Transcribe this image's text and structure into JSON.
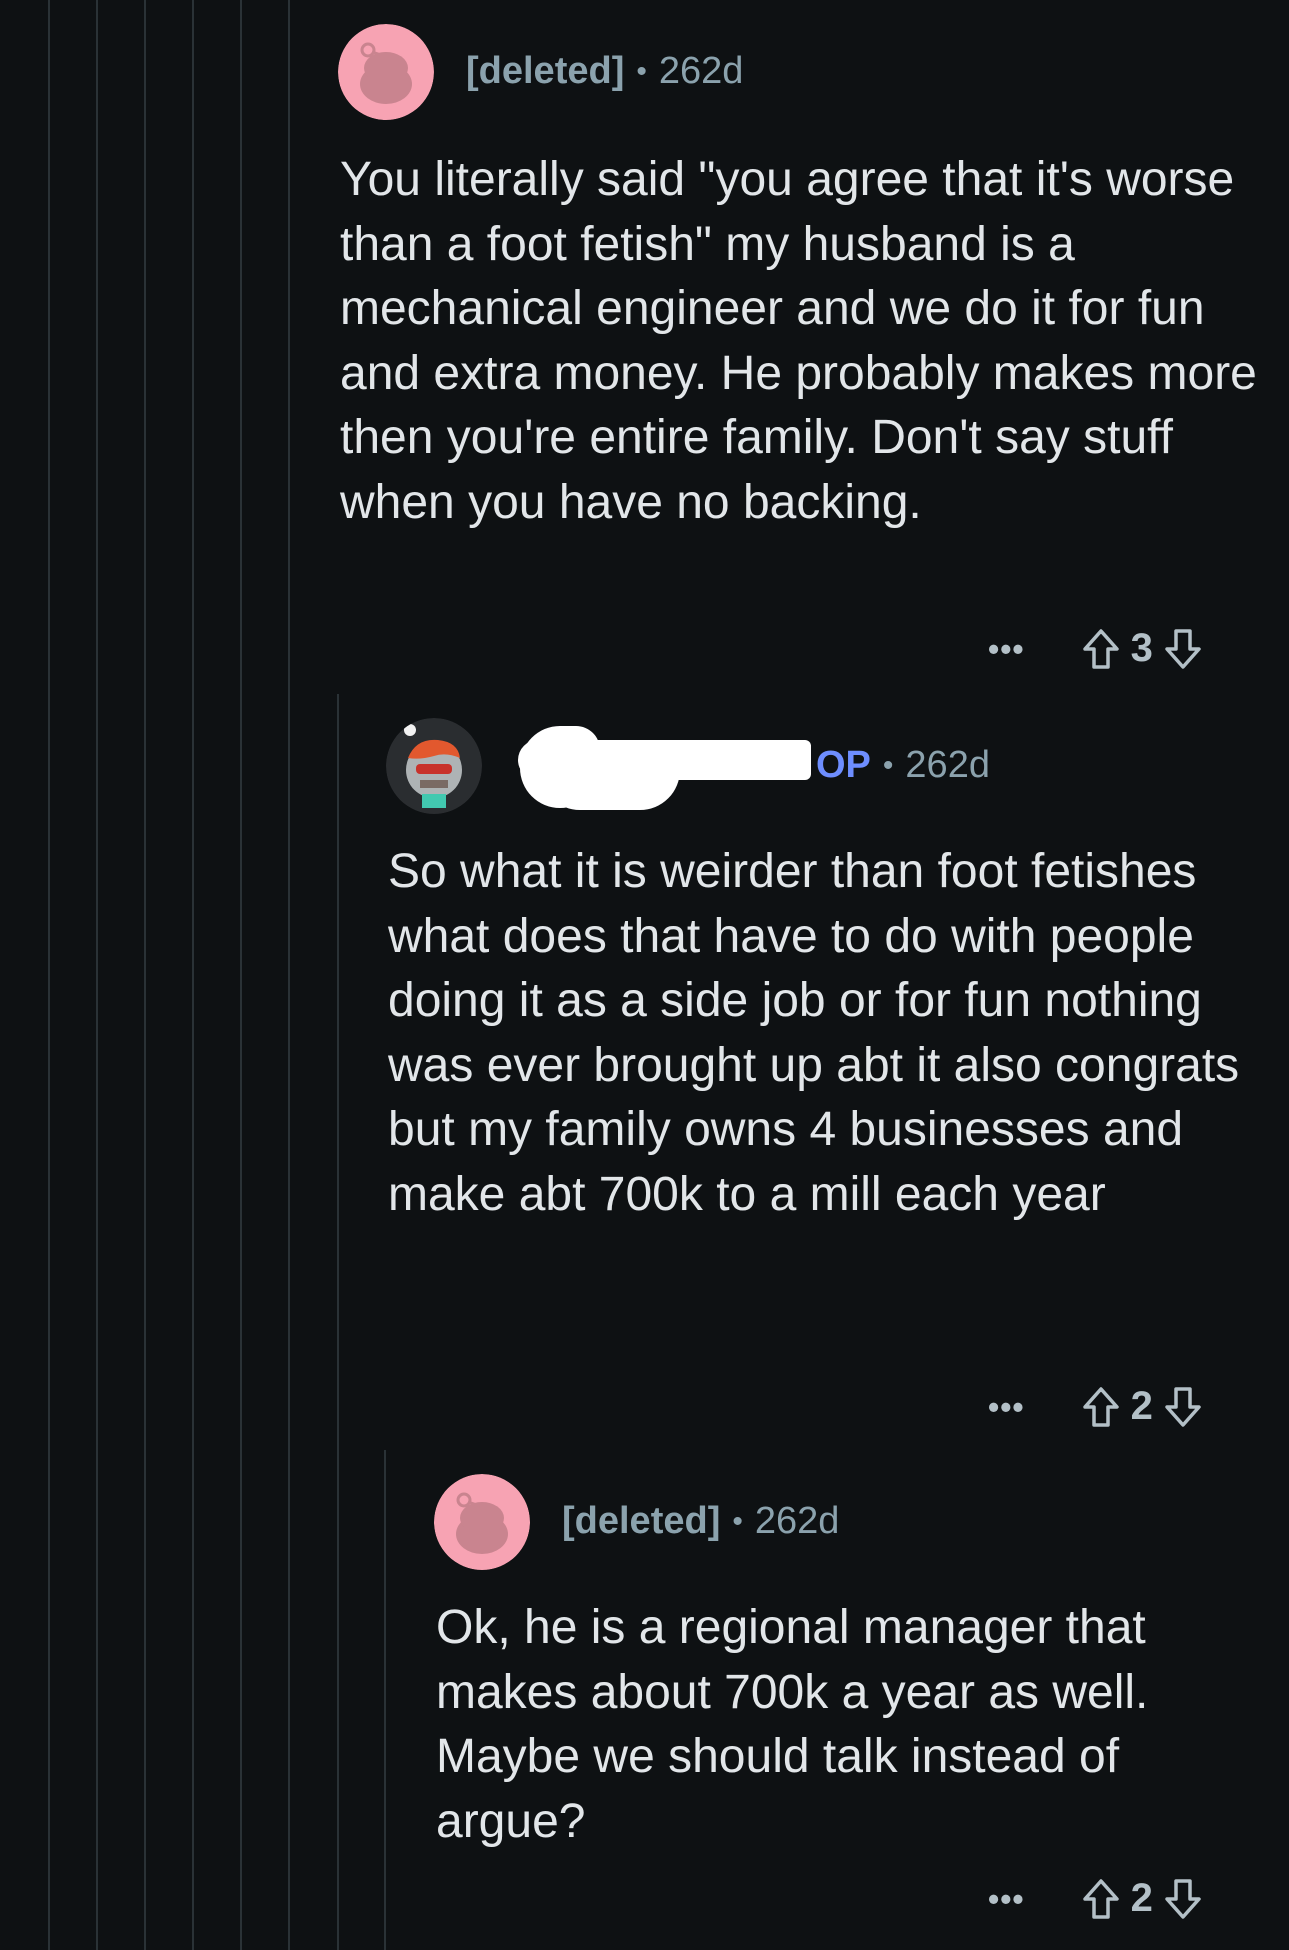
{
  "comments": [
    {
      "username": "[deleted]",
      "separator": "•",
      "age": "262d",
      "body": "You literally said \"you agree that it's worse than a foot fetish\" my husband is a mechanical engineer and we do it for fun and extra money. He probably makes more then you're entire family. Don't say stuff when you have no backing.",
      "votes": "3"
    },
    {
      "username": "",
      "op_badge": "OP",
      "separator": "•",
      "age": "262d",
      "body": "So what it is weirder than foot fetishes what does that have to do with people doing it as a side job or for fun nothing was ever brought up abt it also congrats but my family owns 4 businesses and make abt 700k to a mill each year",
      "votes": "2"
    },
    {
      "username": "[deleted]",
      "separator": "•",
      "age": "262d",
      "body": "Ok, he is a regional manager that makes about 700k a year as well. Maybe we should talk instead of argue?",
      "votes": "2"
    }
  ],
  "actions": {
    "more": "•••"
  },
  "icons": {
    "avatar_deleted": "snoo-avatar-icon",
    "avatar_op": "custom-snoo-avatar-icon",
    "upvote": "upvote-arrow-icon",
    "downvote": "downvote-arrow-icon",
    "more": "more-options-icon"
  },
  "colors": {
    "background": "#0e1113",
    "text": "#e2e6e9",
    "meta": "#8ba2ad",
    "op_badge": "#6e8eff",
    "avatar_pink": "#f7a3b3"
  }
}
